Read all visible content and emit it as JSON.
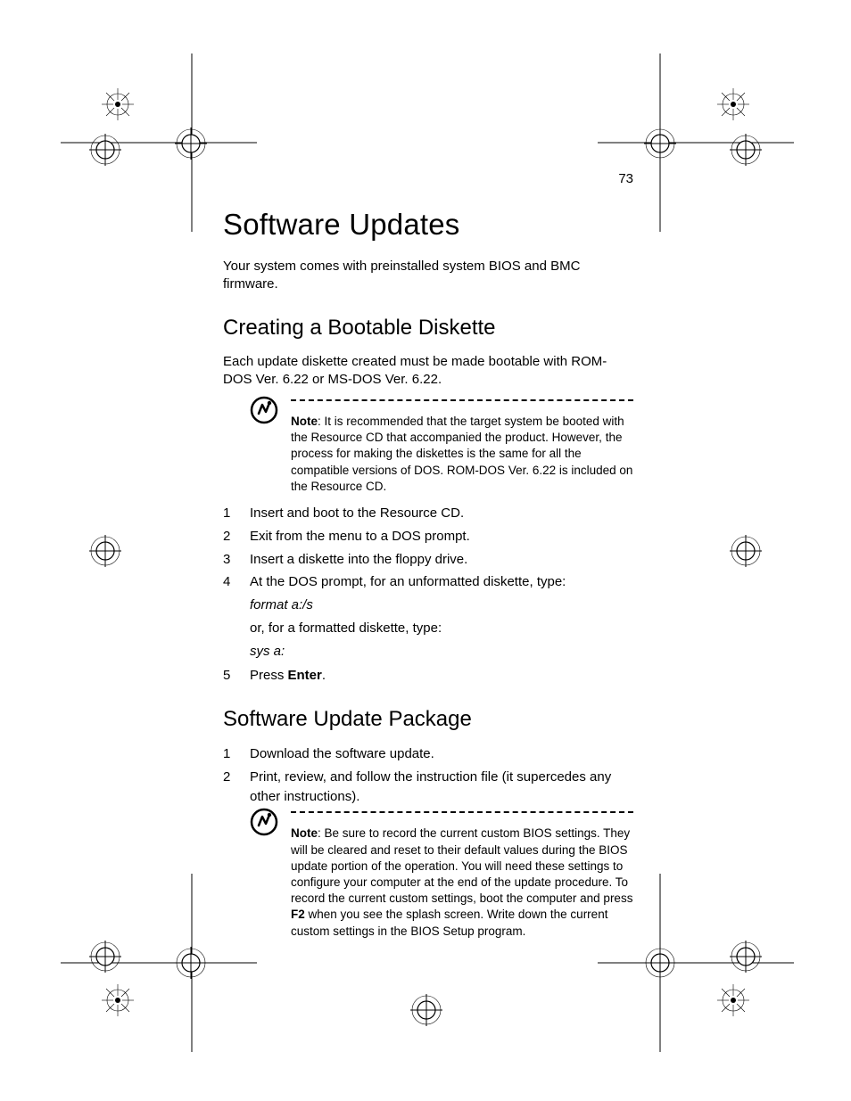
{
  "pageNumber": "73",
  "title": "Software Updates",
  "intro": "Your system comes with preinstalled system BIOS and BMC firmware.",
  "section1": {
    "heading": "Creating a Bootable Diskette",
    "intro": "Each update diskette created must be made bootable with ROM-DOS Ver. 6.22 or MS-DOS Ver. 6.22.",
    "noteLead": "Note",
    "noteText": ": It is recommended that the target system be booted with the Resource CD that accompanied the product. However, the process for making the diskettes is the same for all the compatible versions of DOS. ROM-DOS Ver. 6.22 is included on the Resource CD.",
    "steps": [
      "Insert and boot to the Resource CD.",
      "Exit from the menu to a DOS prompt.",
      "Insert a diskette into the floppy drive.",
      "At the DOS prompt, for an unformatted diskette, type:"
    ],
    "cmd1": "format a:/s",
    "altText": "or, for a formatted diskette, type:",
    "cmd2": "sys a:",
    "step5Pre": "Press ",
    "step5Bold": "Enter",
    "step5Post": "."
  },
  "section2": {
    "heading": "Software Update Package",
    "steps": [
      "Download the software update.",
      "Print, review, and follow the instruction file (it supercedes any other instructions)."
    ],
    "noteLead": "Note",
    "noteTextA": ": Be sure to record the current custom BIOS settings. They will be cleared and reset to their default values during the BIOS update portion of the operation. You will need these settings to configure your computer at the end of the update procedure. To record the current custom settings, boot the computer and press ",
    "noteBold": "F2",
    "noteTextB": " when you see the splash screen. Write down the current custom settings in the BIOS Setup program."
  }
}
